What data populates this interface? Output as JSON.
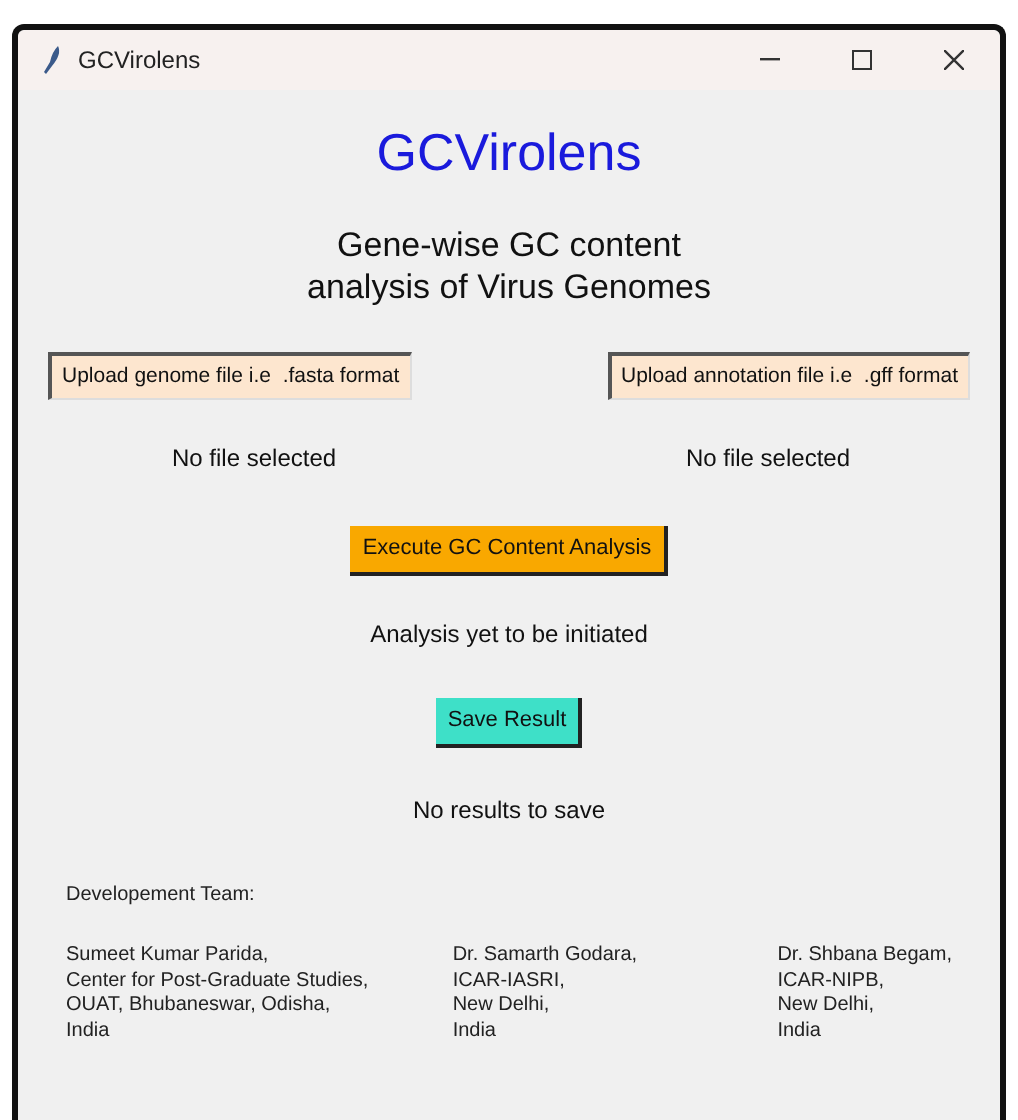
{
  "window": {
    "title": "GCVirolens"
  },
  "app_title": "GCVirolens",
  "subtitle": [
    "Gene-wise GC content",
    "analysis of Virus Genomes"
  ],
  "uploads": [
    {
      "label": "Upload genome file i.e  .fasta format",
      "status": "No file selected"
    },
    {
      "label": "Upload annotation file i.e  .gff format",
      "status": "No file selected"
    }
  ],
  "execute": {
    "label": "Execute GC Content Analysis",
    "status": "Analysis yet to be initiated"
  },
  "save": {
    "label": "Save Result",
    "status": "No results to save"
  },
  "team": {
    "heading": "Developement Team:",
    "members": [
      {
        "lines": [
          "Sumeet Kumar Parida,",
          "Center for Post-Graduate Studies,",
          "OUAT, Bhubaneswar, Odisha,",
          "India"
        ]
      },
      {
        "lines": [
          "Dr. Samarth Godara,",
          "ICAR-IASRI,",
          "New Delhi,",
          "India"
        ]
      },
      {
        "lines": [
          "Dr. Shbana Begam,",
          "ICAR-NIPB,",
          "New Delhi,",
          "India"
        ]
      }
    ]
  }
}
